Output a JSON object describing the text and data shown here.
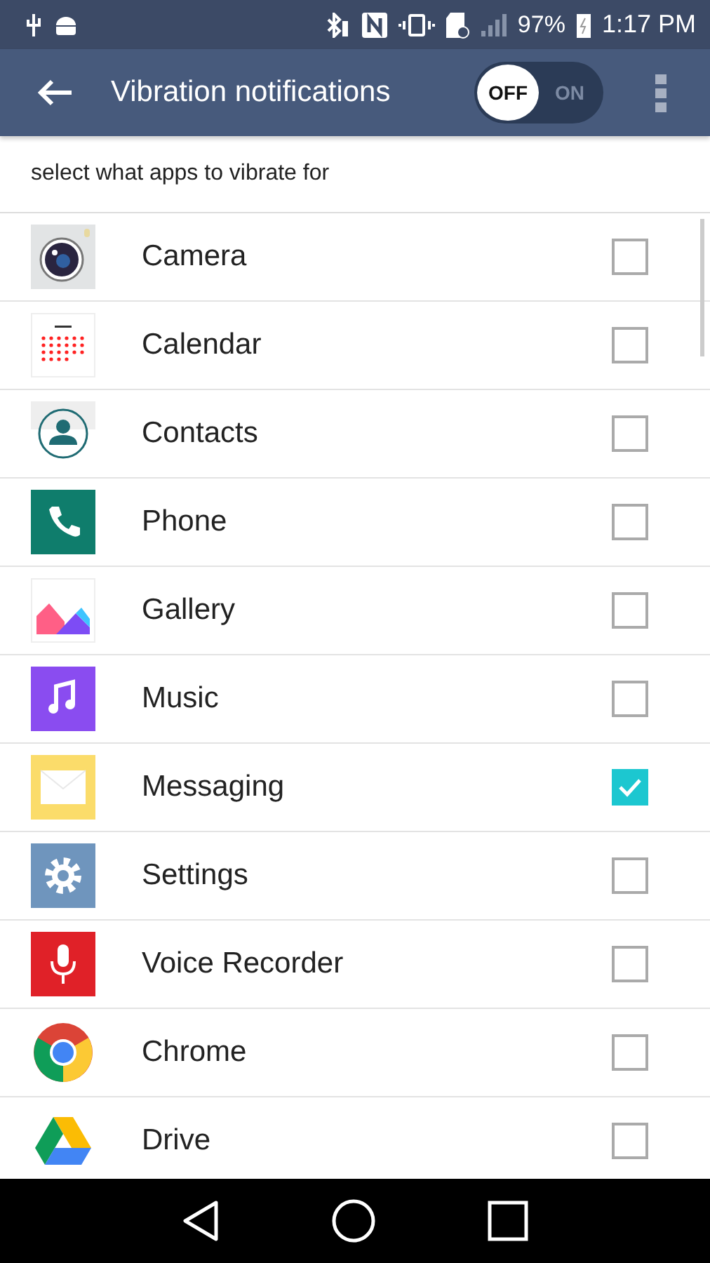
{
  "status_bar": {
    "battery": "97%",
    "time": "1:17 PM"
  },
  "app_bar": {
    "title": "Vibration notifications",
    "toggle": {
      "on": false,
      "off_label": "OFF",
      "on_label": "ON"
    }
  },
  "subtitle": "select what apps to vibrate for",
  "apps": [
    {
      "name": "Camera",
      "checked": false
    },
    {
      "name": "Calendar",
      "checked": false
    },
    {
      "name": "Contacts",
      "checked": false
    },
    {
      "name": "Phone",
      "checked": false
    },
    {
      "name": "Gallery",
      "checked": false
    },
    {
      "name": "Music",
      "checked": false
    },
    {
      "name": "Messaging",
      "checked": true
    },
    {
      "name": "Settings",
      "checked": false
    },
    {
      "name": "Voice Recorder",
      "checked": false
    },
    {
      "name": "Chrome",
      "checked": false
    },
    {
      "name": "Drive",
      "checked": false
    }
  ]
}
